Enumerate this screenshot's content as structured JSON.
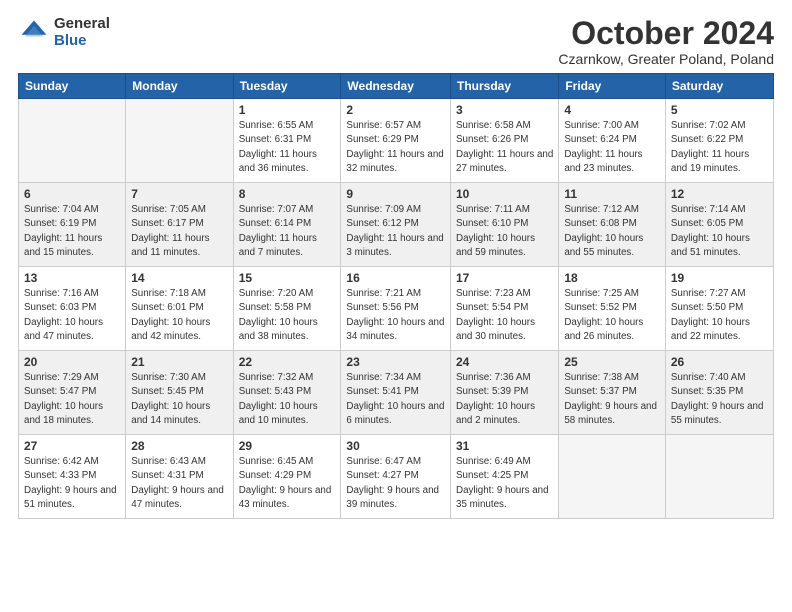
{
  "logo": {
    "general": "General",
    "blue": "Blue"
  },
  "header": {
    "month": "October 2024",
    "location": "Czarnkow, Greater Poland, Poland"
  },
  "days_of_week": [
    "Sunday",
    "Monday",
    "Tuesday",
    "Wednesday",
    "Thursday",
    "Friday",
    "Saturday"
  ],
  "weeks": [
    [
      {
        "day": "",
        "empty": true
      },
      {
        "day": "",
        "empty": true
      },
      {
        "day": "1",
        "sunrise": "Sunrise: 6:55 AM",
        "sunset": "Sunset: 6:31 PM",
        "daylight": "Daylight: 11 hours and 36 minutes."
      },
      {
        "day": "2",
        "sunrise": "Sunrise: 6:57 AM",
        "sunset": "Sunset: 6:29 PM",
        "daylight": "Daylight: 11 hours and 32 minutes."
      },
      {
        "day": "3",
        "sunrise": "Sunrise: 6:58 AM",
        "sunset": "Sunset: 6:26 PM",
        "daylight": "Daylight: 11 hours and 27 minutes."
      },
      {
        "day": "4",
        "sunrise": "Sunrise: 7:00 AM",
        "sunset": "Sunset: 6:24 PM",
        "daylight": "Daylight: 11 hours and 23 minutes."
      },
      {
        "day": "5",
        "sunrise": "Sunrise: 7:02 AM",
        "sunset": "Sunset: 6:22 PM",
        "daylight": "Daylight: 11 hours and 19 minutes."
      }
    ],
    [
      {
        "day": "6",
        "sunrise": "Sunrise: 7:04 AM",
        "sunset": "Sunset: 6:19 PM",
        "daylight": "Daylight: 11 hours and 15 minutes."
      },
      {
        "day": "7",
        "sunrise": "Sunrise: 7:05 AM",
        "sunset": "Sunset: 6:17 PM",
        "daylight": "Daylight: 11 hours and 11 minutes."
      },
      {
        "day": "8",
        "sunrise": "Sunrise: 7:07 AM",
        "sunset": "Sunset: 6:14 PM",
        "daylight": "Daylight: 11 hours and 7 minutes."
      },
      {
        "day": "9",
        "sunrise": "Sunrise: 7:09 AM",
        "sunset": "Sunset: 6:12 PM",
        "daylight": "Daylight: 11 hours and 3 minutes."
      },
      {
        "day": "10",
        "sunrise": "Sunrise: 7:11 AM",
        "sunset": "Sunset: 6:10 PM",
        "daylight": "Daylight: 10 hours and 59 minutes."
      },
      {
        "day": "11",
        "sunrise": "Sunrise: 7:12 AM",
        "sunset": "Sunset: 6:08 PM",
        "daylight": "Daylight: 10 hours and 55 minutes."
      },
      {
        "day": "12",
        "sunrise": "Sunrise: 7:14 AM",
        "sunset": "Sunset: 6:05 PM",
        "daylight": "Daylight: 10 hours and 51 minutes."
      }
    ],
    [
      {
        "day": "13",
        "sunrise": "Sunrise: 7:16 AM",
        "sunset": "Sunset: 6:03 PM",
        "daylight": "Daylight: 10 hours and 47 minutes."
      },
      {
        "day": "14",
        "sunrise": "Sunrise: 7:18 AM",
        "sunset": "Sunset: 6:01 PM",
        "daylight": "Daylight: 10 hours and 42 minutes."
      },
      {
        "day": "15",
        "sunrise": "Sunrise: 7:20 AM",
        "sunset": "Sunset: 5:58 PM",
        "daylight": "Daylight: 10 hours and 38 minutes."
      },
      {
        "day": "16",
        "sunrise": "Sunrise: 7:21 AM",
        "sunset": "Sunset: 5:56 PM",
        "daylight": "Daylight: 10 hours and 34 minutes."
      },
      {
        "day": "17",
        "sunrise": "Sunrise: 7:23 AM",
        "sunset": "Sunset: 5:54 PM",
        "daylight": "Daylight: 10 hours and 30 minutes."
      },
      {
        "day": "18",
        "sunrise": "Sunrise: 7:25 AM",
        "sunset": "Sunset: 5:52 PM",
        "daylight": "Daylight: 10 hours and 26 minutes."
      },
      {
        "day": "19",
        "sunrise": "Sunrise: 7:27 AM",
        "sunset": "Sunset: 5:50 PM",
        "daylight": "Daylight: 10 hours and 22 minutes."
      }
    ],
    [
      {
        "day": "20",
        "sunrise": "Sunrise: 7:29 AM",
        "sunset": "Sunset: 5:47 PM",
        "daylight": "Daylight: 10 hours and 18 minutes."
      },
      {
        "day": "21",
        "sunrise": "Sunrise: 7:30 AM",
        "sunset": "Sunset: 5:45 PM",
        "daylight": "Daylight: 10 hours and 14 minutes."
      },
      {
        "day": "22",
        "sunrise": "Sunrise: 7:32 AM",
        "sunset": "Sunset: 5:43 PM",
        "daylight": "Daylight: 10 hours and 10 minutes."
      },
      {
        "day": "23",
        "sunrise": "Sunrise: 7:34 AM",
        "sunset": "Sunset: 5:41 PM",
        "daylight": "Daylight: 10 hours and 6 minutes."
      },
      {
        "day": "24",
        "sunrise": "Sunrise: 7:36 AM",
        "sunset": "Sunset: 5:39 PM",
        "daylight": "Daylight: 10 hours and 2 minutes."
      },
      {
        "day": "25",
        "sunrise": "Sunrise: 7:38 AM",
        "sunset": "Sunset: 5:37 PM",
        "daylight": "Daylight: 9 hours and 58 minutes."
      },
      {
        "day": "26",
        "sunrise": "Sunrise: 7:40 AM",
        "sunset": "Sunset: 5:35 PM",
        "daylight": "Daylight: 9 hours and 55 minutes."
      }
    ],
    [
      {
        "day": "27",
        "sunrise": "Sunrise: 6:42 AM",
        "sunset": "Sunset: 4:33 PM",
        "daylight": "Daylight: 9 hours and 51 minutes."
      },
      {
        "day": "28",
        "sunrise": "Sunrise: 6:43 AM",
        "sunset": "Sunset: 4:31 PM",
        "daylight": "Daylight: 9 hours and 47 minutes."
      },
      {
        "day": "29",
        "sunrise": "Sunrise: 6:45 AM",
        "sunset": "Sunset: 4:29 PM",
        "daylight": "Daylight: 9 hours and 43 minutes."
      },
      {
        "day": "30",
        "sunrise": "Sunrise: 6:47 AM",
        "sunset": "Sunset: 4:27 PM",
        "daylight": "Daylight: 9 hours and 39 minutes."
      },
      {
        "day": "31",
        "sunrise": "Sunrise: 6:49 AM",
        "sunset": "Sunset: 4:25 PM",
        "daylight": "Daylight: 9 hours and 35 minutes."
      },
      {
        "day": "",
        "empty": true
      },
      {
        "day": "",
        "empty": true
      }
    ]
  ]
}
